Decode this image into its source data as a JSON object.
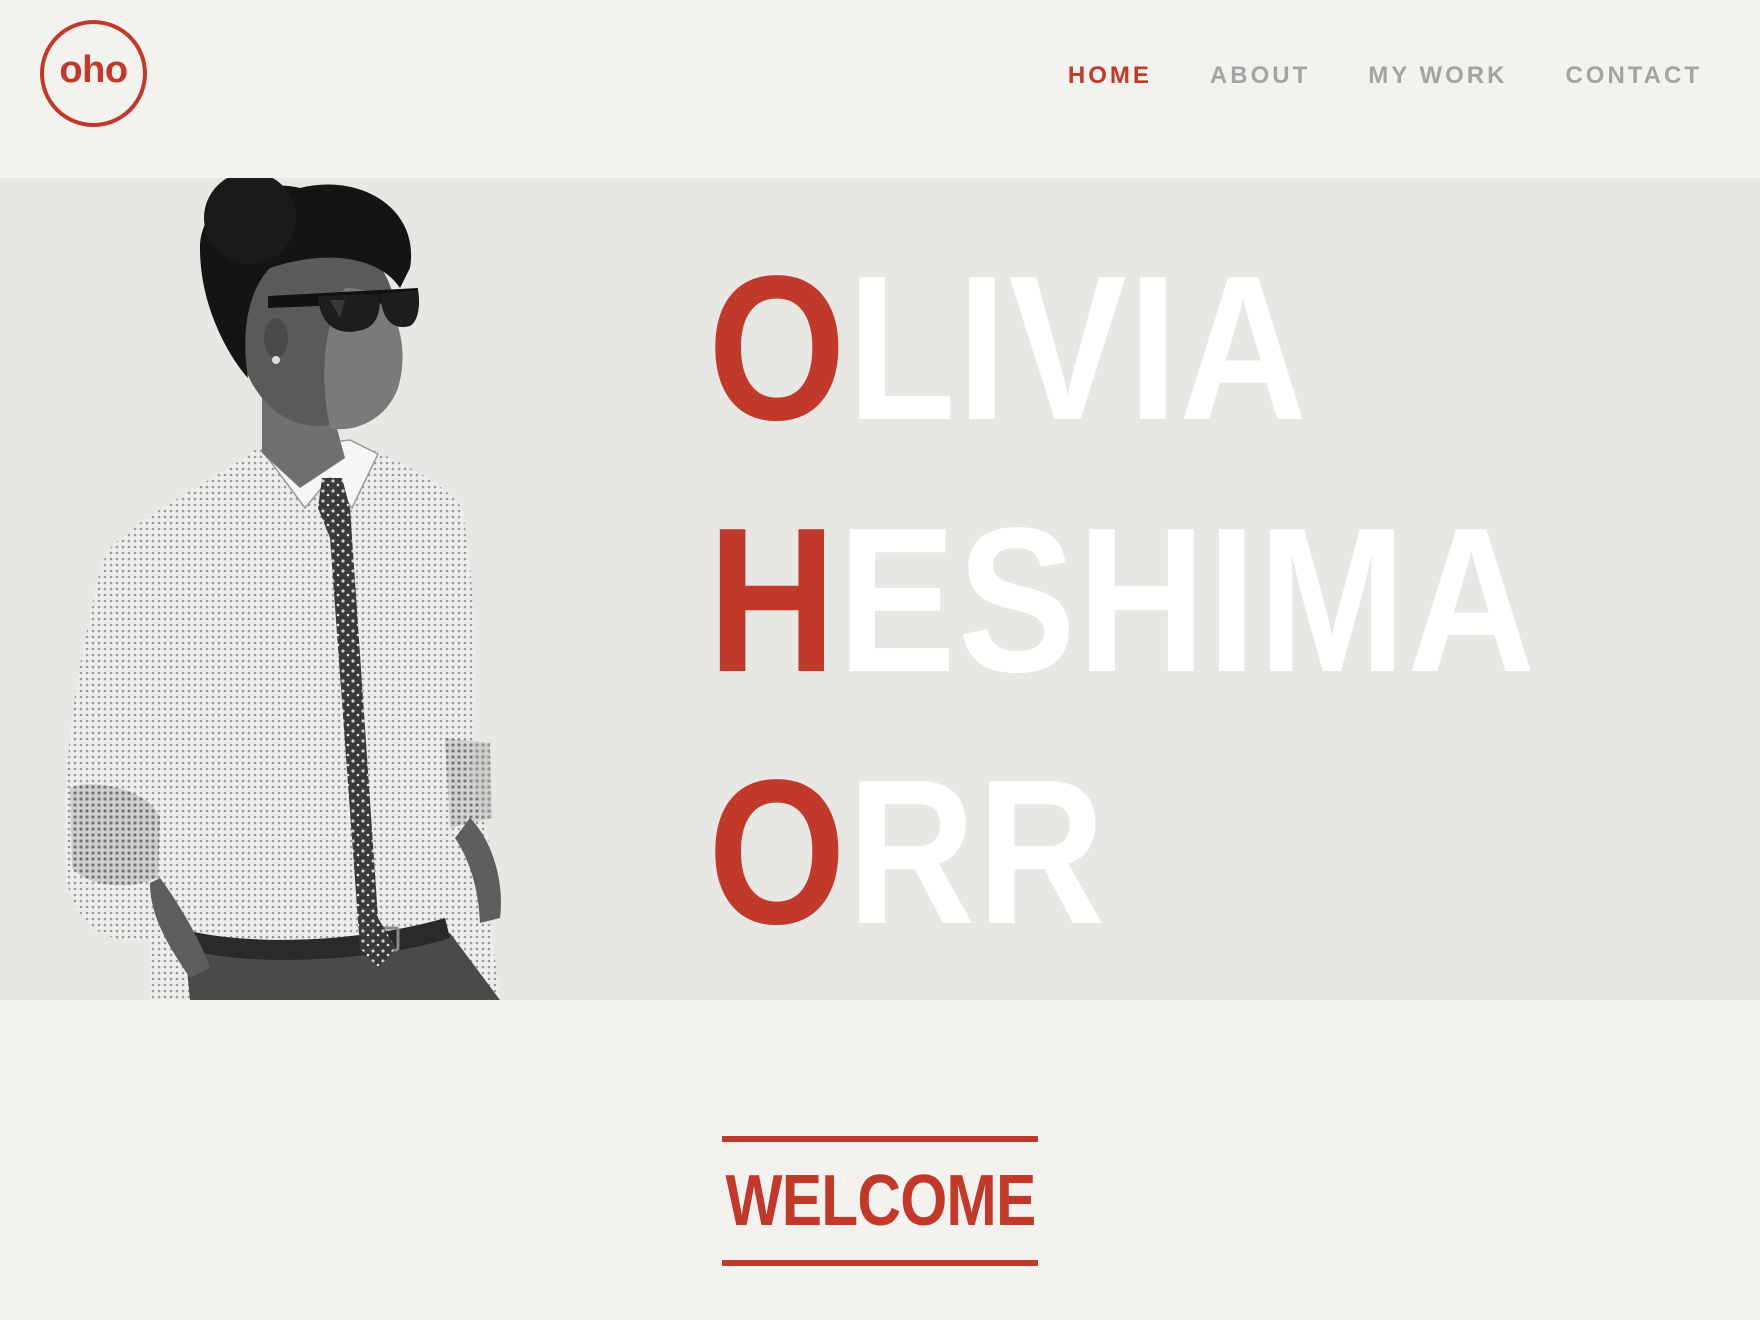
{
  "brand": {
    "logo_text": "oho",
    "accent_color": "#c0392b",
    "muted_color": "#a3a3a3"
  },
  "nav": {
    "items": [
      {
        "label": "HOME",
        "active": true
      },
      {
        "label": "ABOUT",
        "active": false
      },
      {
        "label": "MY WORK",
        "active": false
      },
      {
        "label": "CONTACT",
        "active": false
      }
    ]
  },
  "hero": {
    "name_lines": [
      {
        "initial": "O",
        "rest": "LIVIA"
      },
      {
        "initial": "H",
        "rest": "ESHIMA"
      },
      {
        "initial": "O",
        "rest": "RR"
      }
    ],
    "portrait": "halftone black-and-white photo of a woman in sunglasses, dress shirt and patterned tie"
  },
  "welcome": {
    "heading": "WELCOME"
  }
}
